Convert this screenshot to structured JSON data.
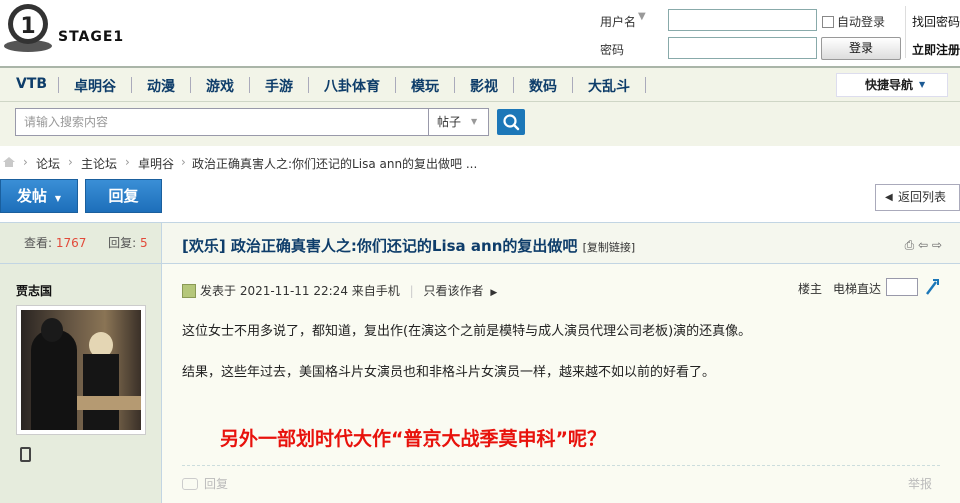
{
  "header": {
    "logo_text": "STAGE1",
    "login": {
      "username_label": "用户名",
      "password_label": "密码",
      "auto_login": "自动登录",
      "login_button": "登录",
      "find_password": "找回密码",
      "register": "立即注册"
    }
  },
  "nav": {
    "items": [
      "VTB",
      "卓明谷",
      "动漫",
      "游戏",
      "手游",
      "八卦体育",
      "模玩",
      "影视",
      "数码",
      "大乱斗"
    ],
    "quick_nav": "快捷导航"
  },
  "search": {
    "placeholder": "请输入搜索内容",
    "type": "帖子"
  },
  "breadcrumb": {
    "items": [
      "论坛",
      "主论坛",
      "卓明谷",
      "政治正确真害人之:你们还记的Lisa ann的复出做吧 ..."
    ]
  },
  "actions": {
    "new_post": "发帖",
    "reply": "回复",
    "back_list": "返回列表"
  },
  "thread": {
    "views_label": "查看:",
    "views": "1767",
    "replies_label": "回复:",
    "replies": "5",
    "title": "[欢乐] 政治正确真害人之:你们还记的Lisa ann的复出做吧",
    "copy_link": "[复制链接]"
  },
  "post": {
    "author": "贾志国",
    "meta": "发表于 2021-11-11 22:24 来自手机",
    "only_author": "只看该作者",
    "floor": "楼主",
    "jump_label": "电梯直达",
    "line1": "这位女士不用多说了，都知道，复出作(在演这个之前是模特与成人演员代理公司老板)演的还真像。",
    "line2": "结果，这些年过去，美国格斗片女演员也和非格斗片女演员一样，越来越不如以前的好看了。",
    "line3": "另外一部划时代大作“普京大战季莫申科”呢？",
    "reply": "回复",
    "report": "举报"
  },
  "colors": {
    "accent": "#1c77b8",
    "nav_text": "#0e3d6a",
    "red_text": "#e8120c",
    "count": "#e24a3a"
  }
}
